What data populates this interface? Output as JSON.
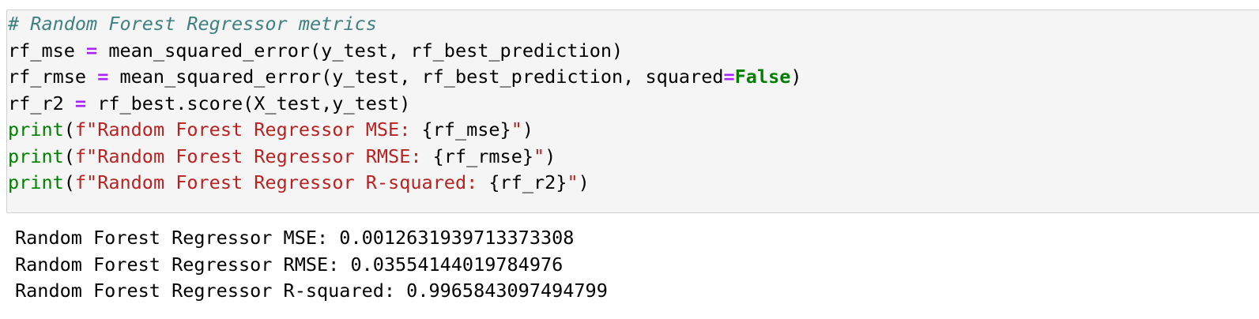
{
  "code_cell": {
    "comment": "# Random Forest Regressor metrics",
    "line2": {
      "var": "rf_mse ",
      "op": "=",
      "rest": " mean_squared_error(y_test, rf_best_prediction)"
    },
    "line3": {
      "var": "rf_rmse ",
      "op": "=",
      "rest": " mean_squared_error(y_test, rf_best_prediction, squared",
      "op2": "=",
      "const": "False",
      "close": ")"
    },
    "line4": {
      "var": "rf_r2 ",
      "op": "=",
      "rest": " rf_best.score(X_test,y_test)"
    },
    "line5": {
      "func": "print",
      "open": "(",
      "str_prefix": "f\"Random Forest Regressor MSE: ",
      "interp": "{rf_mse}",
      "str_suffix": "\"",
      "close": ")"
    },
    "line6": {
      "func": "print",
      "open": "(",
      "str_prefix": "f\"Random Forest Regressor RMSE: ",
      "interp": "{rf_rmse}",
      "str_suffix": "\"",
      "close": ")"
    },
    "line7": {
      "func": "print",
      "open": "(",
      "str_prefix": "f\"Random Forest Regressor R-squared: ",
      "interp": "{rf_r2}",
      "str_suffix": "\"",
      "close": ")"
    }
  },
  "output_cell": {
    "lines": [
      "Random Forest Regressor MSE: 0.0012631939713373308",
      "Random Forest Regressor RMSE: 0.03554144019784976",
      "Random Forest Regressor R-squared: 0.9965843097494799"
    ]
  },
  "colors": {
    "cell_background": "#f5f5f5",
    "cell_border": "#cfcfcf",
    "comment": "#408080",
    "operator": "#aa22ff",
    "builtin": "#008000",
    "string": "#ba2121"
  }
}
